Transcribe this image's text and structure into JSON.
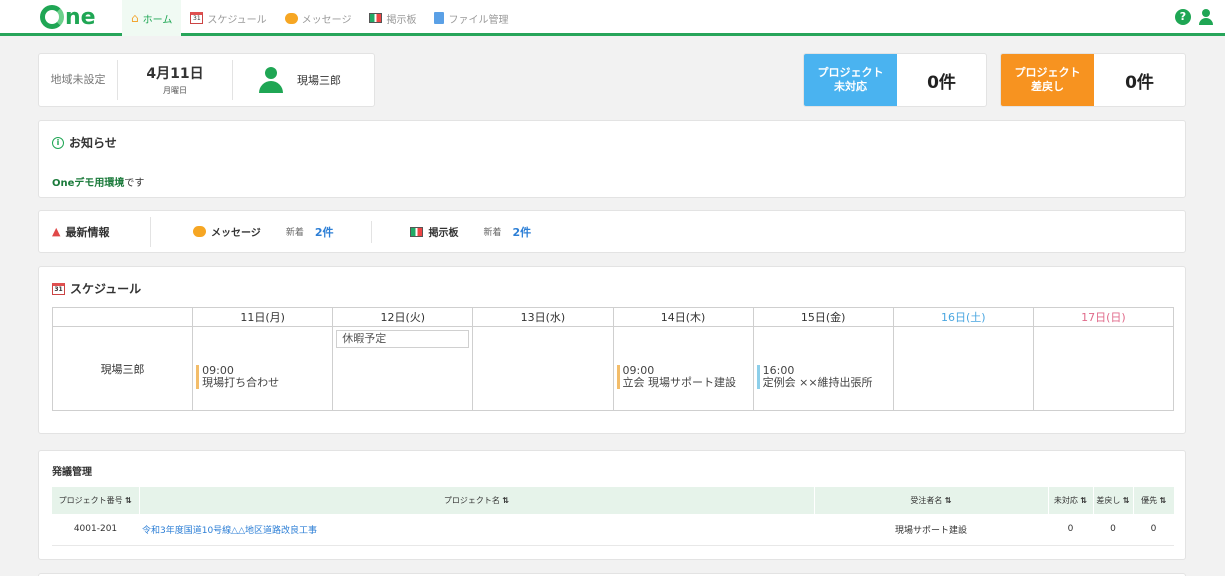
{
  "nav": {
    "logo": "One",
    "items": [
      {
        "label": "ホーム",
        "icon": "home-icon",
        "active": true
      },
      {
        "label": "スケジュール",
        "icon": "calendar-icon",
        "active": false
      },
      {
        "label": "メッセージ",
        "icon": "message-icon",
        "active": false
      },
      {
        "label": "掲示板",
        "icon": "board-icon",
        "active": false
      },
      {
        "label": "ファイル管理",
        "icon": "file-icon",
        "active": false
      }
    ],
    "help": "?"
  },
  "user_card": {
    "region": "地域未設定",
    "date": "4月11日",
    "weekday": "月曜日",
    "user_name": "現場三郎"
  },
  "stats": [
    {
      "label": "プロジェクト未対応",
      "value": "0件",
      "color": "#4ab3f0"
    },
    {
      "label": "プロジェクト差戻し",
      "value": "0件",
      "color": "#f79320"
    }
  ],
  "notice": {
    "title": "お知らせ",
    "text_bold": "Oneデモ用環境",
    "text_rest": "です"
  },
  "latest": {
    "title": "最新情報",
    "items": [
      {
        "label": "メッセージ",
        "new_label": "新着",
        "count": "2件"
      },
      {
        "label": "掲示板",
        "new_label": "新着",
        "count": "2件"
      }
    ]
  },
  "schedule": {
    "title": "スケジュール",
    "days": [
      "11日(月)",
      "12日(火)",
      "13日(水)",
      "14日(木)",
      "15日(金)",
      "16日(土)",
      "17日(日)"
    ],
    "person": "現場三郎",
    "holiday": "休暇予定",
    "events": [
      {
        "day": 0,
        "time": "09:00",
        "title": "現場打ち合わせ"
      },
      {
        "day": 3,
        "time": "09:00",
        "title": "立会 現場サポート建設"
      },
      {
        "day": 4,
        "time": "16:00",
        "title": "定例会 ××維持出張所"
      }
    ]
  },
  "orders": {
    "title": "発議管理",
    "columns": [
      "プロジェクト番号",
      "プロジェクト名",
      "受注者名",
      "未対応",
      "差戻し",
      "優先"
    ],
    "rows": [
      {
        "number": "4001-201",
        "name": "令和3年度国道10号線△△地区道路改良工事",
        "contractor": "現場サポート建設",
        "pending": "0",
        "returned": "0",
        "priority": "0"
      }
    ]
  }
}
